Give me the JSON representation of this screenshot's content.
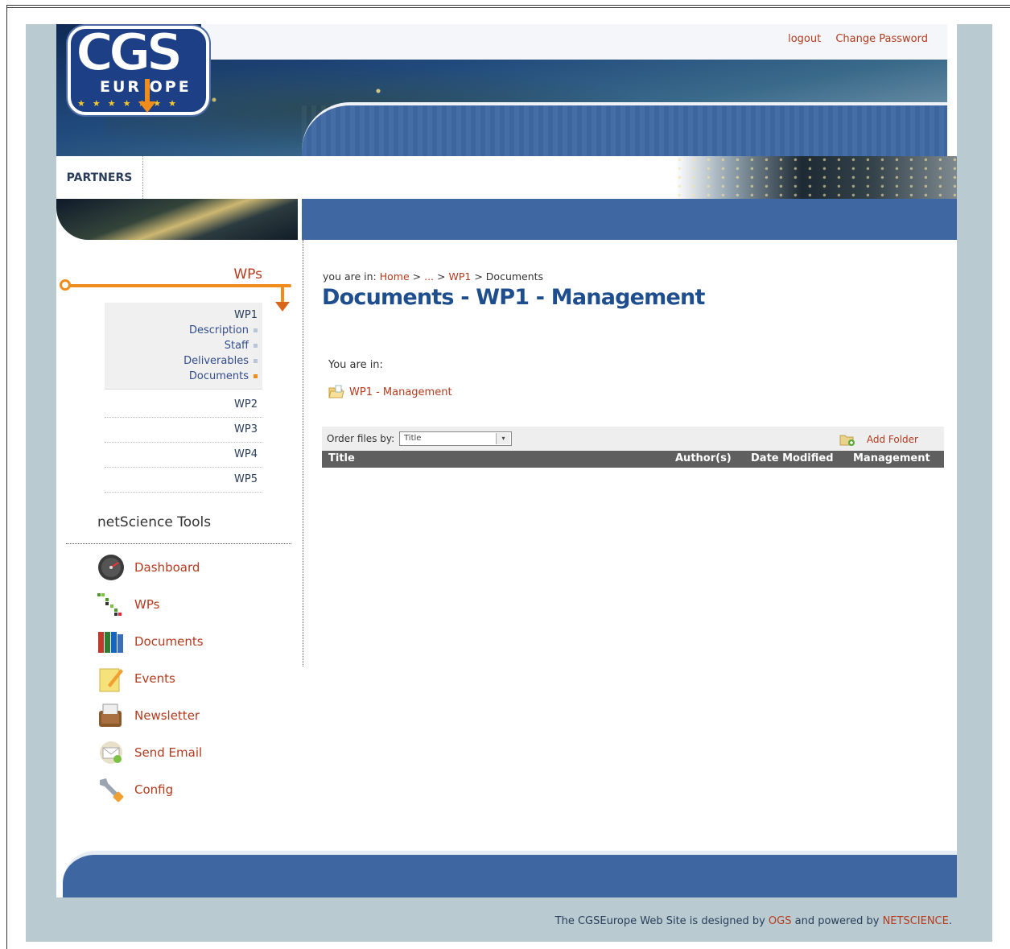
{
  "header": {
    "logo": {
      "letters": "CGS",
      "sub": "EUR OPE"
    },
    "links": {
      "logout": "logout",
      "change_password": "Change Password"
    }
  },
  "nav": {
    "partners": "PARTNERS"
  },
  "sidebar": {
    "wps_title": "WPs",
    "wp1": {
      "label": "WP1",
      "items": [
        {
          "label": "Description",
          "active": false
        },
        {
          "label": "Staff",
          "active": false
        },
        {
          "label": "Deliverables",
          "active": false
        },
        {
          "label": "Documents",
          "active": true
        }
      ]
    },
    "wps": [
      "WP2",
      "WP3",
      "WP4",
      "WP5"
    ],
    "tools_title": "netScience Tools",
    "tools": [
      {
        "label": "Dashboard",
        "icon": "dashboard-icon"
      },
      {
        "label": "WPs",
        "icon": "wps-icon"
      },
      {
        "label": "Documents",
        "icon": "documents-icon"
      },
      {
        "label": "Events",
        "icon": "events-icon"
      },
      {
        "label": "Newsletter",
        "icon": "newsletter-icon"
      },
      {
        "label": "Send Email",
        "icon": "send-email-icon"
      },
      {
        "label": "Config",
        "icon": "config-icon"
      }
    ]
  },
  "main": {
    "breadcrumb": {
      "prefix": "you are in:",
      "home": "Home",
      "sep1": ">",
      "ellipsis": "...",
      "sep2": ">",
      "wp1": "WP1",
      "sep3": ">",
      "current": "Documents"
    },
    "title": "Documents - WP1 - Management",
    "you_are_in": "You are in:",
    "folder": "WP1 - Management",
    "toolbar": {
      "order_label": "Order files by:",
      "order_value": "Title",
      "add_folder": "Add Folder"
    },
    "table": {
      "columns": [
        "Title",
        "Author(s)",
        "Date Modified",
        "Management"
      ],
      "rows": []
    }
  },
  "footer": {
    "text1": "The CGSEurope Web Site is designed by",
    "ogs": "OGS",
    "text2": "and powered by",
    "netscience": "NETSCIENCE",
    "end": "."
  },
  "colors": {
    "accent_red": "#b23b1e",
    "accent_orange": "#f08c1b",
    "header_blue": "#3f68a3",
    "title_blue": "#1e4e8e"
  }
}
